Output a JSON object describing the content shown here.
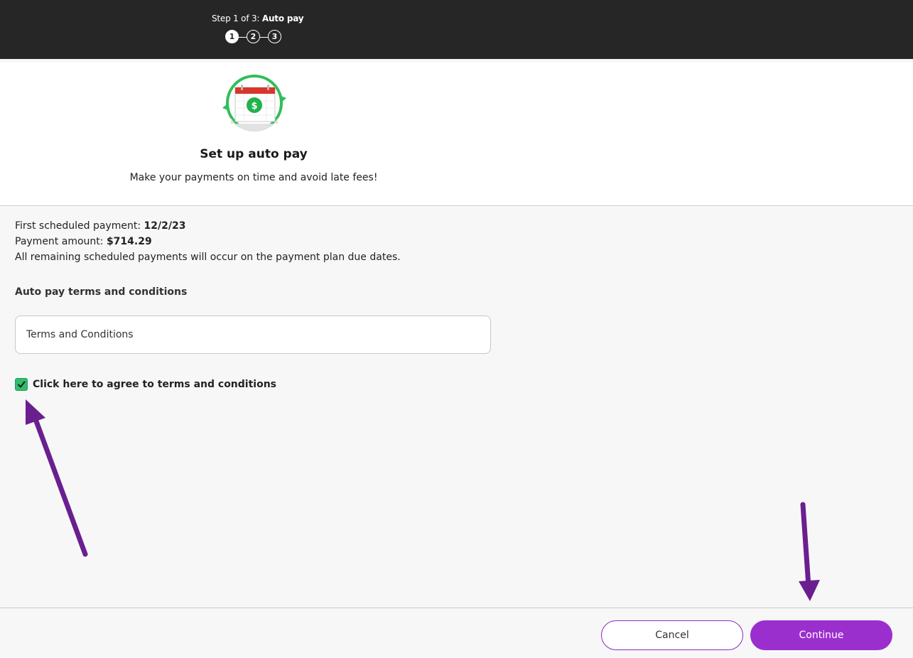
{
  "header": {
    "step_prefix": "Step 1 of 3:",
    "step_name": "Auto pay",
    "steps": [
      "1",
      "2",
      "3"
    ]
  },
  "hero": {
    "icon": "calendar-dollar-refresh-icon",
    "title": "Set up auto pay",
    "subtitle": "Make your payments on time and avoid late fees!"
  },
  "info": {
    "first_payment_label": "First scheduled payment:",
    "first_payment_value": "12/2/23",
    "amount_label": "Payment amount:",
    "amount_value": "$714.29",
    "note": "All remaining scheduled payments will occur on the payment plan due dates."
  },
  "terms": {
    "heading": "Auto pay terms and conditions",
    "box_label": "Terms and Conditions",
    "agree_label": "Click here to agree to terms and conditions",
    "agreed": true
  },
  "footer": {
    "cancel_label": "Cancel",
    "continue_label": "Continue"
  },
  "colors": {
    "accent": "#9b2fce",
    "check": "#2fbe6e",
    "annotation_arrow": "#6a1f8f"
  }
}
